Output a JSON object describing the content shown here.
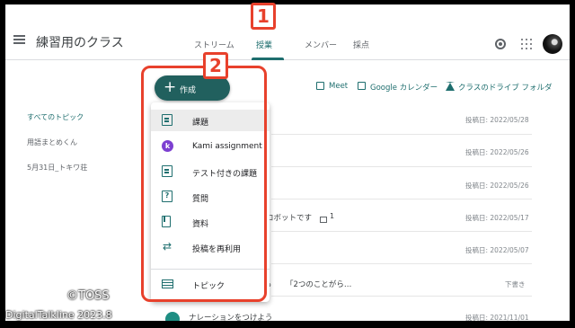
{
  "header": {
    "class_title": "練習用のクラス",
    "tabs": [
      {
        "label": "ストリーム"
      },
      {
        "label": "授業"
      },
      {
        "label": "メンバー"
      },
      {
        "label": "採点"
      }
    ],
    "active_tab": "授業"
  },
  "callouts": [
    "1",
    "2"
  ],
  "create_button": {
    "label": "作成",
    "icon": "plus-icon"
  },
  "toolbar": {
    "meet": "Meet",
    "calendar": "Google カレンダー",
    "drive": "クラスのドライブ フォルダ"
  },
  "topics": [
    {
      "label": "すべてのトピック"
    },
    {
      "label": "用語まとめくん"
    },
    {
      "label": "5月31日_トキワ荘"
    }
  ],
  "create_menu": [
    {
      "label": "課題",
      "icon": "assignment-icon"
    },
    {
      "label": "Kami assignment",
      "icon": "kami-icon"
    },
    {
      "label": "テスト付きの課題",
      "icon": "quiz-assignment-icon"
    },
    {
      "label": "質問",
      "icon": "question-icon"
    },
    {
      "label": "資料",
      "icon": "material-icon"
    },
    {
      "label": "投稿を再利用",
      "icon": "reuse-icon"
    },
    {
      "label": "トピック",
      "icon": "topic-icon"
    }
  ],
  "posts": [
    {
      "date": "投稿日: 2022/05/28"
    },
    {
      "date": "投稿日: 2022/05/26"
    },
    {
      "date": "投稿日: 2022/05/26"
    },
    {
      "title": "ロボットです",
      "comments": "1",
      "date": "投稿日: 2022/05/17"
    },
    {
      "date": "投稿日: 2022/05/07"
    },
    {
      "title": "「2つのことがら…",
      "status": "下書き"
    },
    {
      "title": "ナレーションをつけよう",
      "date": "投稿日: 2021/11/01"
    }
  ],
  "partial_row_text": "ら",
  "overlay": {
    "copyright": "©TOSS",
    "watermark": "DigitalTalkline 2023.8"
  },
  "colors": {
    "accent": "#1e6e6e",
    "callout": "#e8412c",
    "create_button": "#21605e"
  }
}
